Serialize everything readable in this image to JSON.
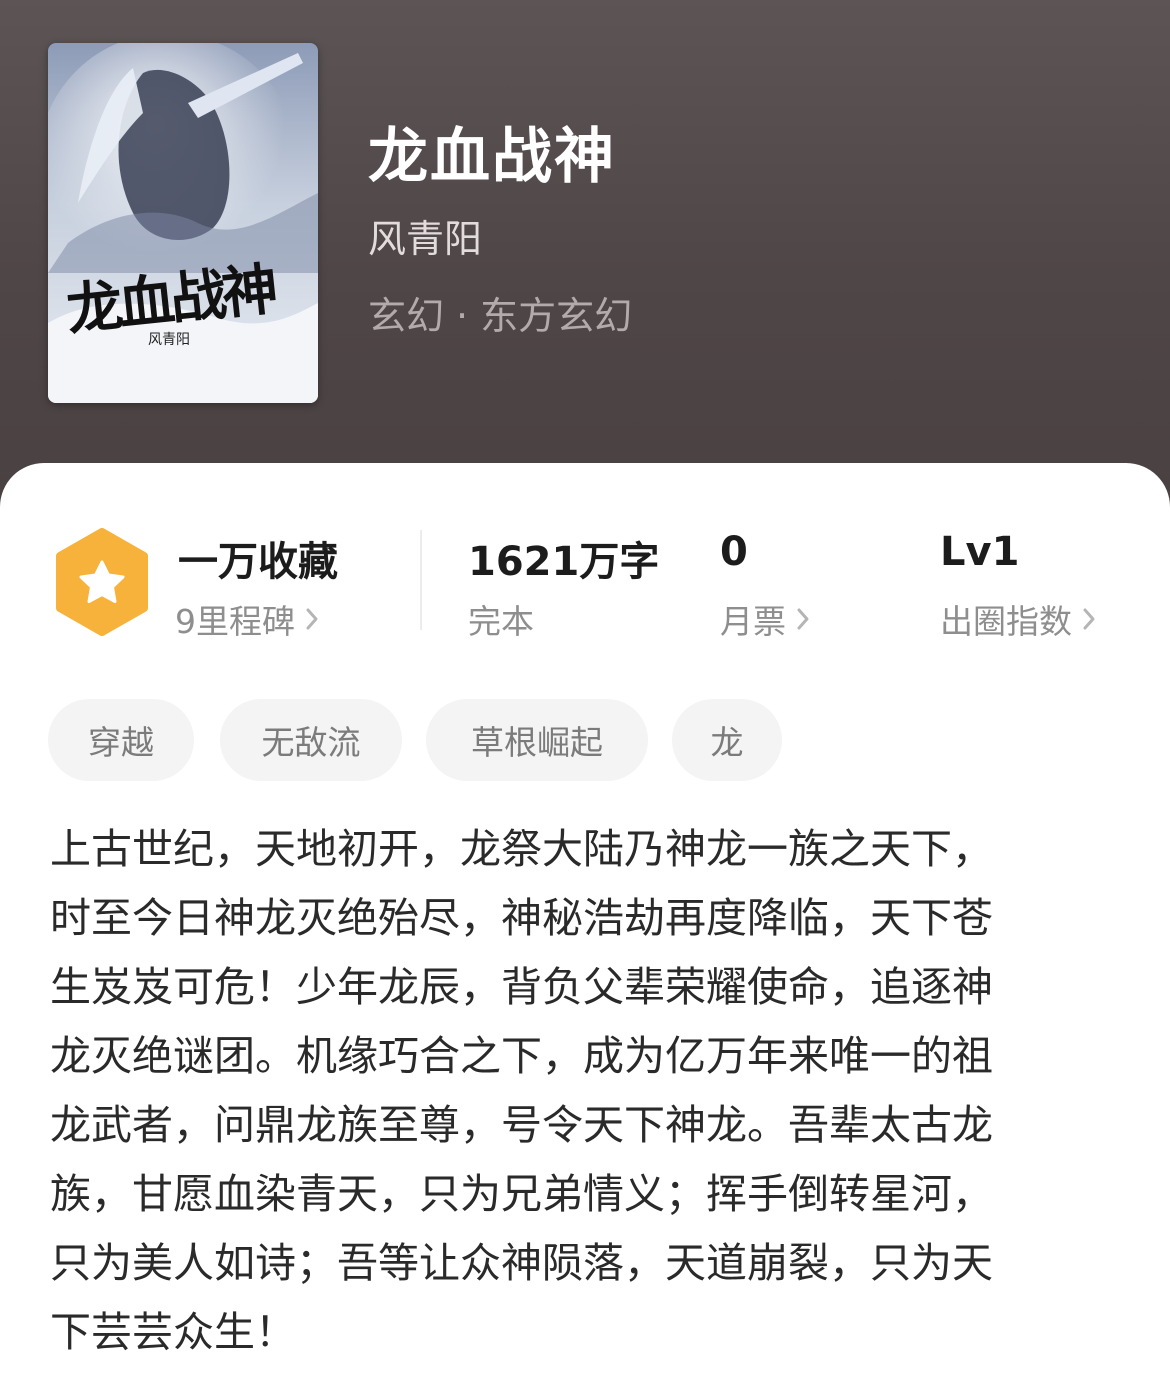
{
  "book": {
    "cover_title": "龙血战神",
    "cover_author": "风青阳",
    "title": "龙血战神",
    "author": "风青阳",
    "genre": "玄幻",
    "genre_separator": "·",
    "subgenre": "东方玄幻"
  },
  "stats": {
    "favorites": {
      "value": "一万收藏",
      "label": "9里程碑"
    },
    "words": {
      "value": "1621万字",
      "label": "完本"
    },
    "monthly_votes": {
      "value": "0",
      "label": "月票"
    },
    "circle_index": {
      "value": "Lv1",
      "label": "出圈指数"
    }
  },
  "tags": [
    "穿越",
    "无敌流",
    "草根崛起",
    "龙"
  ],
  "description": "上古世纪，天地初开，龙祭大陆乃神龙一族之天下，\n时至今日神龙灭绝殆尽，神秘浩劫再度降临，天下苍\n生岌岌可危！少年龙辰，背负父辈荣耀使命，追逐神\n龙灭绝谜团。机缘巧合之下，成为亿万年来唯一的祖\n龙武者，问鼎龙族至尊，号令天下神龙。吾辈太古龙\n族，甘愿血染青天，只为兄弟情义；挥手倒转星河，\n只为美人如诗；吾等让众神陨落，天道崩裂，只为天\n下芸芸众生！",
  "colors": {
    "header_bg": "#4f4647",
    "badge_orange": "#f6b23a",
    "text_primary": "#1c1c1c",
    "text_secondary": "#8e8e8e",
    "tag_bg": "#f4f4f4"
  },
  "icons": {
    "badge": "star-hexagon-icon",
    "chevron": "chevron-right-icon"
  }
}
